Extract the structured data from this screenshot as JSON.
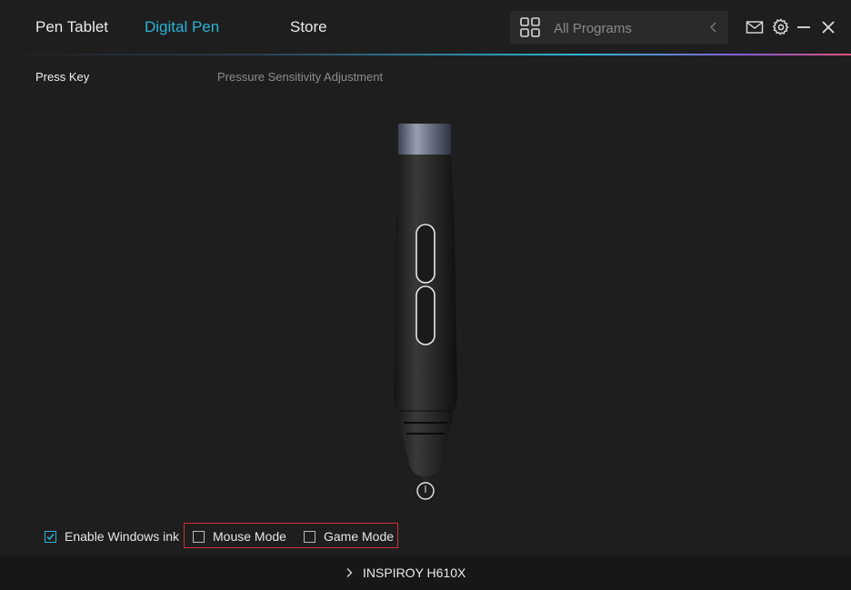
{
  "nav": {
    "tabs": [
      {
        "label": "Pen Tablet",
        "active": false
      },
      {
        "label": "Digital Pen",
        "active": true
      },
      {
        "label": "Store",
        "active": false
      }
    ]
  },
  "search": {
    "placeholder": "All Programs",
    "icon": "grid-icon",
    "back_icon": "chevron-left-icon"
  },
  "window_controls": [
    "mail-icon",
    "gear-icon",
    "minimize-icon",
    "close-icon"
  ],
  "subtabs": [
    {
      "label": "Press Key",
      "active": true
    },
    {
      "label": "Pressure Sensitivity Adjustment",
      "active": false
    }
  ],
  "options": {
    "windows_ink": {
      "label": "Enable Windows ink",
      "checked": true
    },
    "mouse_mode": {
      "label": "Mouse Mode",
      "checked": false
    },
    "game_mode": {
      "label": "Game Mode",
      "checked": false
    }
  },
  "footer": {
    "device_name": "INSPIROY H610X"
  },
  "colors": {
    "background": "#1e1e1e",
    "accent": "#2bb3d6",
    "highlight_border": "#d0303a",
    "footer": "#171717"
  }
}
